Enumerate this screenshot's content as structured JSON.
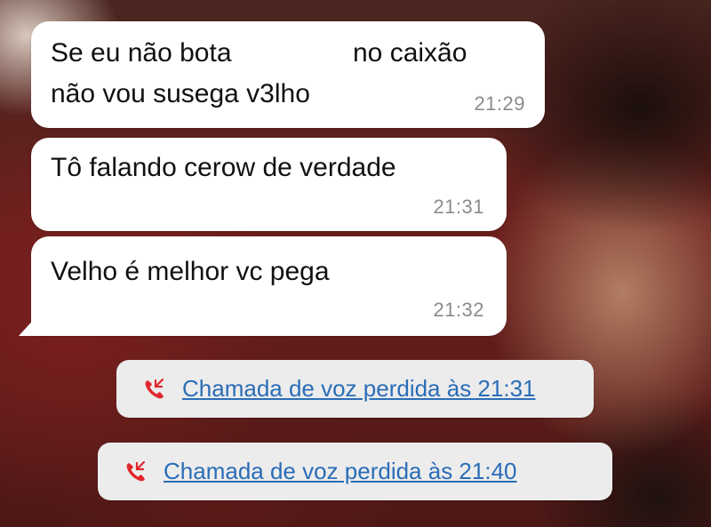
{
  "messages": [
    {
      "line1_part1": "Se eu não bota",
      "line1_part2": "no caixão",
      "line2": "não vou susega v3lho",
      "time": "21:29"
    },
    {
      "line1": "Tô falando cerow de verdade",
      "time": "21:31"
    },
    {
      "line1": "Velho é melhor vc pega",
      "time": "21:32"
    }
  ],
  "missed_calls": [
    {
      "label": "Chamada de voz perdida às 21:31",
      "icon": "missed-call-icon"
    },
    {
      "label": "Chamada de voz perdida às 21:40",
      "icon": "missed-call-icon"
    }
  ],
  "colors": {
    "bubble": "#ffffff",
    "call_pill": "#ececec",
    "call_link": "#2a6db8",
    "missed_icon": "#e0262d",
    "timestamp": "#8b8b8b"
  }
}
